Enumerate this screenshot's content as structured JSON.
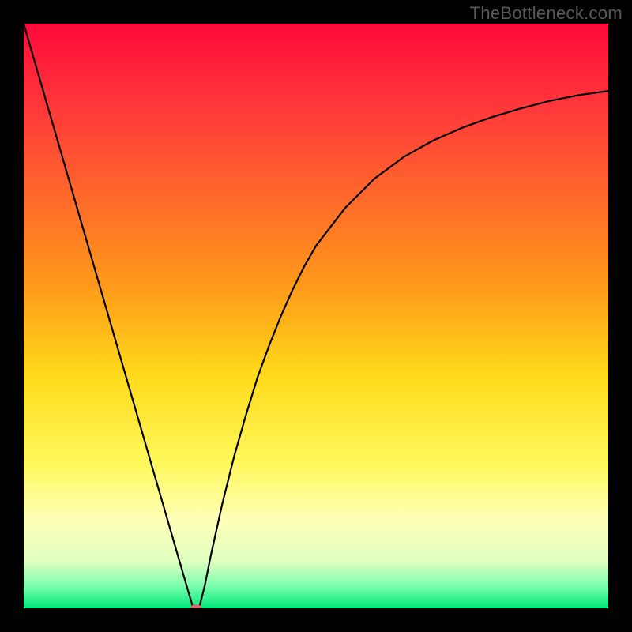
{
  "watermark": "TheBottleneck.com",
  "chart_data": {
    "type": "line",
    "title": "",
    "xlabel": "",
    "ylabel": "",
    "xlim": [
      0,
      100
    ],
    "ylim": [
      0,
      100
    ],
    "grid": false,
    "legend": null,
    "background_gradient_stops": [
      {
        "offset": 0.0,
        "color": "#ff0a3a"
      },
      {
        "offset": 0.15,
        "color": "#ff3a3a"
      },
      {
        "offset": 0.3,
        "color": "#ff6a2a"
      },
      {
        "offset": 0.45,
        "color": "#ff9a1a"
      },
      {
        "offset": 0.6,
        "color": "#ffda1a"
      },
      {
        "offset": 0.75,
        "color": "#fff85a"
      },
      {
        "offset": 0.85,
        "color": "#fdffb8"
      },
      {
        "offset": 0.92,
        "color": "#dfffc0"
      },
      {
        "offset": 0.96,
        "color": "#80ffb0"
      },
      {
        "offset": 1.0,
        "color": "#00e878"
      }
    ],
    "series": [
      {
        "name": "bottleneck-curve",
        "stroke": "#000000",
        "stroke_width": 2.2,
        "x": [
          0,
          2,
          4,
          6,
          8,
          10,
          12,
          14,
          16,
          18,
          20,
          22,
          24,
          26,
          28,
          29,
          30,
          31,
          32,
          34,
          36,
          38,
          40,
          42,
          44,
          46,
          48,
          50,
          55,
          60,
          65,
          70,
          75,
          80,
          85,
          90,
          95,
          100
        ],
        "y": [
          100,
          93.1,
          86.2,
          79.3,
          72.4,
          65.5,
          58.6,
          51.7,
          44.8,
          37.9,
          31.0,
          24.1,
          17.2,
          10.3,
          3.4,
          0.0,
          0.0,
          4.0,
          9.0,
          18.0,
          26.0,
          33.0,
          39.5,
          45.0,
          50.0,
          54.5,
          58.5,
          62.0,
          68.5,
          73.5,
          77.2,
          80.0,
          82.2,
          84.0,
          85.5,
          86.8,
          87.8,
          88.5
        ]
      }
    ],
    "marker": {
      "name": "optimal-point",
      "x": 29.5,
      "y": 0.0,
      "rx": 1.0,
      "ry": 0.7,
      "fill": "#d46a6a"
    }
  }
}
